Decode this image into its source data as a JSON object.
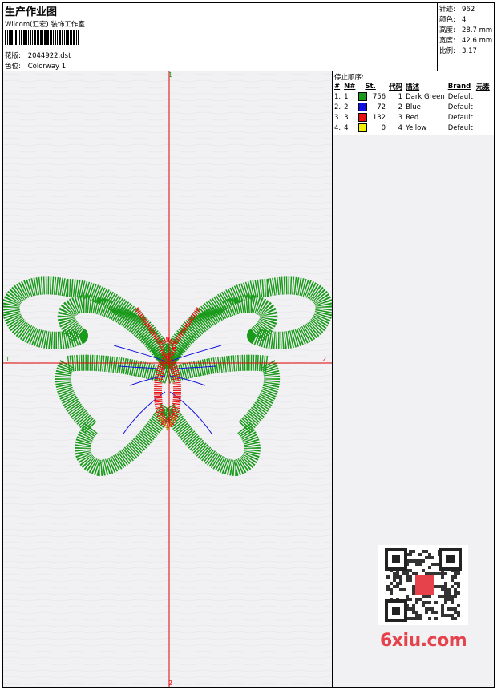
{
  "header": {
    "title": "生产作业图",
    "company": "Wilcom(汇宏) 装饰工作室",
    "design_label": "花版:",
    "design_value": "2044922.dst",
    "colorway_label": "色位:",
    "colorway_value": "Colorway 1"
  },
  "stats": [
    {
      "label": "针迹:",
      "value": "962"
    },
    {
      "label": "颜色:",
      "value": "4"
    },
    {
      "label": "高度:",
      "value": "28.7 mm"
    },
    {
      "label": "宽度:",
      "value": "42.6 mm"
    },
    {
      "label": "比例:",
      "value": "3.17"
    }
  ],
  "sequence": {
    "title": "停止顺序:",
    "headers": [
      "#",
      "N#",
      "St.",
      "代码",
      "描述",
      "Brand",
      "元素"
    ],
    "rows": [
      {
        "idx": "1.",
        "n": "1",
        "color": "#1a9a1a",
        "stitches": "756",
        "code": "1",
        "desc": "Dark Green",
        "brand": "Default"
      },
      {
        "idx": "2.",
        "n": "2",
        "color": "#1010e0",
        "stitches": "72",
        "code": "2",
        "desc": "Blue",
        "brand": "Default"
      },
      {
        "idx": "3.",
        "n": "3",
        "color": "#e81010",
        "stitches": "132",
        "code": "3",
        "desc": "Red",
        "brand": "Default"
      },
      {
        "idx": "4.",
        "n": "4",
        "color": "#f0f000",
        "stitches": "0",
        "code": "4",
        "desc": "Yellow",
        "brand": "Default"
      }
    ]
  },
  "axes": {
    "top": "1",
    "bottom": "2",
    "left": "1",
    "right": "2"
  },
  "watermark": "6xiu.com",
  "colors": {
    "green": "#1a9a1a",
    "blue": "#1010e0",
    "red": "#e81010",
    "axis": "#e00000"
  }
}
